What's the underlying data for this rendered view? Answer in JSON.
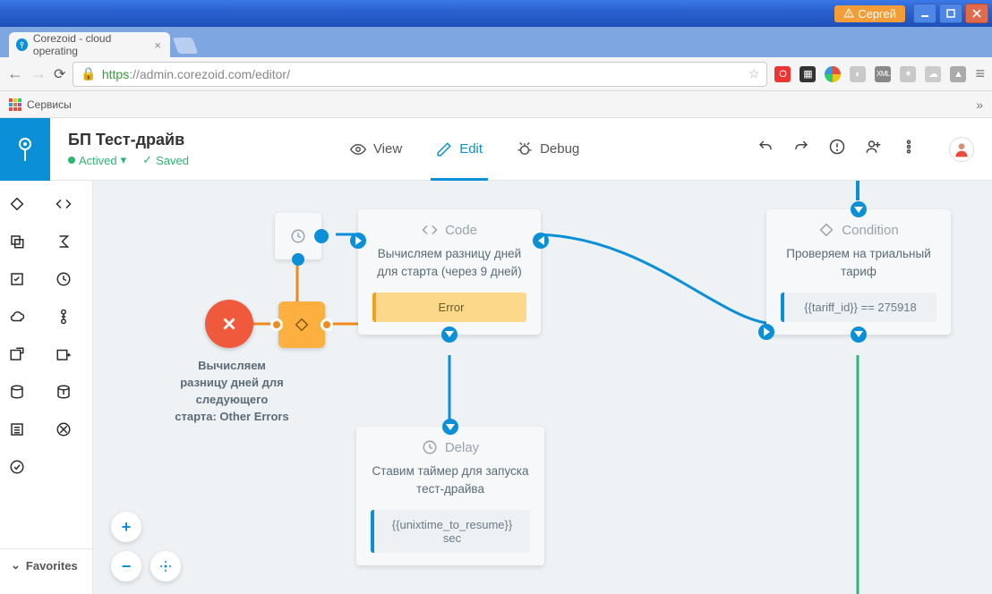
{
  "os": {
    "user": "Сергей"
  },
  "browser": {
    "tab_title": "Corezoid - cloud operating",
    "url_https": "https",
    "url_host": "://admin.corezoid.com",
    "url_path": "/editor/",
    "bookmark_services": "Сервисы"
  },
  "app": {
    "title": "БП Тест-драйв",
    "status_active": "Actived",
    "status_saved": "Saved",
    "tabs": {
      "view": "View",
      "edit": "Edit",
      "debug": "Debug"
    },
    "favorites": "Favorites"
  },
  "nodes": {
    "code": {
      "type": "Code",
      "desc": "Вычисляем разницу дней для старта (через 9 дней)",
      "error": "Error"
    },
    "condition": {
      "type": "Condition",
      "desc": "Проверяем на триальный тариф",
      "rule": "{{tariff_id}} == 275918"
    },
    "delay": {
      "type": "Delay",
      "desc": "Ставим таймер для запуска тест-драйва",
      "rule": "{{unixtime_to_resume}} sec"
    },
    "error_node": "Вычисляем разницу дней для следующего старта: Other Errors"
  }
}
